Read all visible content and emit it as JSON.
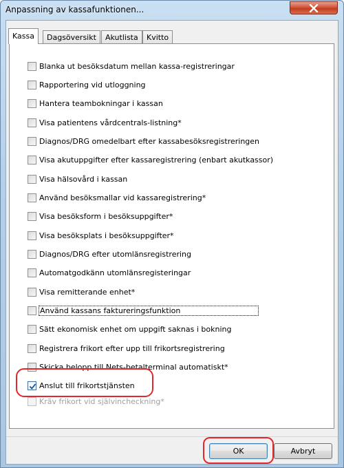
{
  "window": {
    "title": "Anpassning av kassafunktionen..."
  },
  "tabs": [
    {
      "label": "Kassa",
      "active": true
    },
    {
      "label": "Dagsöversikt",
      "active": false
    },
    {
      "label": "Akutlista",
      "active": false
    },
    {
      "label": "Kvitto",
      "active": false
    }
  ],
  "options": [
    {
      "label": "Blanka ut besöksdatum mellan kassa-registreringar",
      "checked": false,
      "enabled": true
    },
    {
      "label": "Rapportering vid utloggning",
      "checked": false,
      "enabled": true
    },
    {
      "label": "Hantera teambokningar i kassan",
      "checked": false,
      "enabled": true
    },
    {
      "label": "Visa patientens vårdcentrals-listning*",
      "checked": false,
      "enabled": true
    },
    {
      "label": "Diagnos/DRG omedelbart efter kassabesöksregistreringen",
      "checked": false,
      "enabled": true
    },
    {
      "label": "Visa akutuppgifter efter kassaregistrering (enbart akutkassor)",
      "checked": false,
      "enabled": true
    },
    {
      "label": "Visa hälsovård i kassan",
      "checked": false,
      "enabled": true
    },
    {
      "label": "Använd besöksmallar vid kassaregistrering*",
      "checked": false,
      "enabled": true
    },
    {
      "label": "Visa besöksform i besöksuppgifter*",
      "checked": false,
      "enabled": true
    },
    {
      "label": "Visa besöksplats i besöksuppgifter*",
      "checked": false,
      "enabled": true
    },
    {
      "label": "Diagnos/DRG efter utomlänsregistrering",
      "checked": false,
      "enabled": true
    },
    {
      "label": "Automatgodkänn utomlänsregisteringar",
      "checked": false,
      "enabled": true
    },
    {
      "label": "Visa remitterande enhet*",
      "checked": false,
      "enabled": true
    },
    {
      "label": "Använd kassans faktureringsfunktion",
      "checked": false,
      "enabled": true
    },
    {
      "label": "Sätt ekonomisk enhet om uppgift saknas i bokning",
      "checked": false,
      "enabled": true
    },
    {
      "label": "Registrera frikort efter upp till frikortsregistrering",
      "checked": false,
      "enabled": true
    },
    {
      "label": "Skicka belopp till Nets-betalterminal automatiskt*",
      "checked": false,
      "enabled": true
    },
    {
      "label": "Anslut till frikortstjänsten",
      "checked": true,
      "enabled": true
    },
    {
      "label": "Kräv frikort vid självincheckning*",
      "checked": false,
      "enabled": false
    }
  ],
  "buttons": {
    "ok": "OK",
    "cancel": "Avbryt"
  },
  "colors": {
    "annotation": "#e3262b",
    "close_button": "#c23d1e"
  }
}
